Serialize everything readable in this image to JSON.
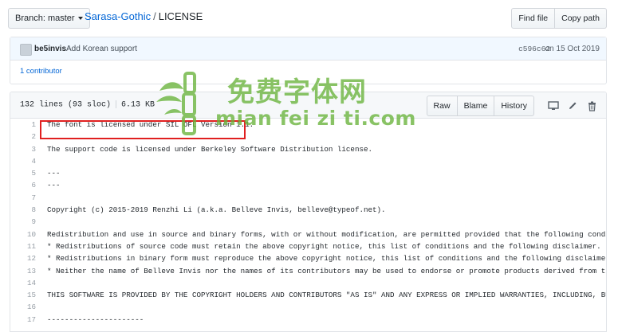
{
  "toolbar": {
    "branch_label": "Branch: master",
    "repo": "Sarasa-Gothic",
    "separator": "/",
    "file": "LICENSE",
    "find_file": "Find file",
    "copy_path": "Copy path"
  },
  "commit": {
    "author": "be5invis",
    "message": "Add Korean support",
    "sha": "c596c62",
    "date": "on 15 Oct 2019",
    "contributors": "1 contributor"
  },
  "file": {
    "lines": "132 lines (93 sloc)",
    "size": "6.13 KB",
    "raw": "Raw",
    "blame": "Blame",
    "history": "History"
  },
  "icons": {
    "desktop": "desktop-icon",
    "edit": "pencil-icon",
    "delete": "trash-icon"
  },
  "code_lines": [
    {
      "n": "1",
      "text": "The font is licensed under SIL OFL Version 1.1."
    },
    {
      "n": "2",
      "text": ""
    },
    {
      "n": "3",
      "text": "The support code is licensed under Berkeley Software Distribution license."
    },
    {
      "n": "4",
      "text": ""
    },
    {
      "n": "5",
      "text": "---"
    },
    {
      "n": "6",
      "text": "---"
    },
    {
      "n": "7",
      "text": ""
    },
    {
      "n": "8",
      "text": "Copyright (c) 2015-2019 Renzhi Li (a.k.a. Belleve Invis, belleve@typeof.net)."
    },
    {
      "n": "9",
      "text": ""
    },
    {
      "n": "10",
      "text": "Redistribution and use in source and binary forms, with or without modification, are permitted provided that the following conditions are met:"
    },
    {
      "n": "11",
      "text": "* Redistributions of source code must retain the above copyright notice, this list of conditions and the following disclaimer."
    },
    {
      "n": "12",
      "text": "* Redistributions in binary form must reproduce the above copyright notice, this list of conditions and the following disclaimer in the documentation"
    },
    {
      "n": "13",
      "text": "* Neither the name of Belleve Invis nor the names of its contributors may be used to endorse or promote products derived from this software without"
    },
    {
      "n": "14",
      "text": ""
    },
    {
      "n": "15",
      "text": "THIS SOFTWARE IS PROVIDED BY THE COPYRIGHT HOLDERS AND CONTRIBUTORS \"AS IS\" AND ANY EXPRESS OR IMPLIED WARRANTIES, INCLUDING, BUT NOT LIMITED TO"
    },
    {
      "n": "16",
      "text": ""
    },
    {
      "n": "17",
      "text": "----------------------"
    }
  ],
  "watermark": {
    "cn": "免费字体网",
    "en": "mian fei zi ti.com"
  },
  "colors": {
    "link": "#0366d6",
    "highlight": "#e02020",
    "watermark": "#69b33a"
  }
}
